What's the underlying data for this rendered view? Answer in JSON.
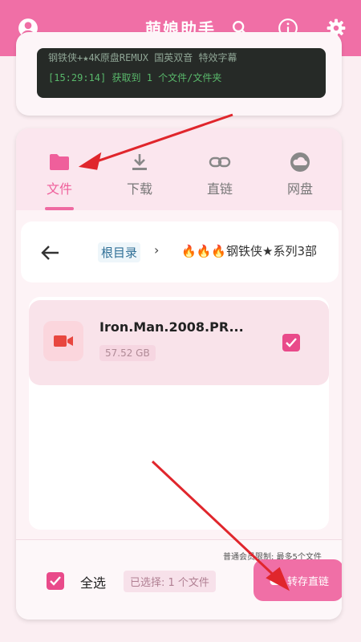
{
  "app": {
    "title": "萌娘助手"
  },
  "header": {
    "account_icon": "account-circle-icon",
    "search_icon": "search-icon",
    "info_icon": "info-icon",
    "settings_icon": "gear-icon"
  },
  "log": {
    "line1": "钢铁侠+★4K原盘REMUX 国英双音 特效字幕",
    "line2": "[15:29:14] 获取到 1 个文件/文件夹"
  },
  "tabs": [
    {
      "label": "文件",
      "icon": "folder-icon",
      "active": true
    },
    {
      "label": "下载",
      "icon": "download-icon",
      "active": false
    },
    {
      "label": "直链",
      "icon": "link-icon",
      "active": false
    },
    {
      "label": "网盘",
      "icon": "cloud-icon",
      "active": false
    }
  ],
  "breadcrumb": {
    "back_icon": "arrow-left-icon",
    "root": "根目录",
    "separator": "›",
    "flames": "🔥🔥🔥",
    "current": "钢铁侠★系列3部"
  },
  "files": [
    {
      "name": "Iron.Man.2008.PR...",
      "size": "57.52 GB",
      "icon": "video-icon",
      "checked": true
    }
  ],
  "footer": {
    "limit_note": "普通会员限制: 最多5个文件",
    "select_all_label": "全选",
    "selected_text": "已选择: 1 个文件",
    "save_button": "转存直链",
    "save_icon": "cloud-upload-icon"
  },
  "colors": {
    "accent": "#f06fa6",
    "checkbox": "#e94a8a",
    "console_bg": "#262a27",
    "console_text": "#59b86b",
    "annotation_arrow": "#e0262c"
  }
}
